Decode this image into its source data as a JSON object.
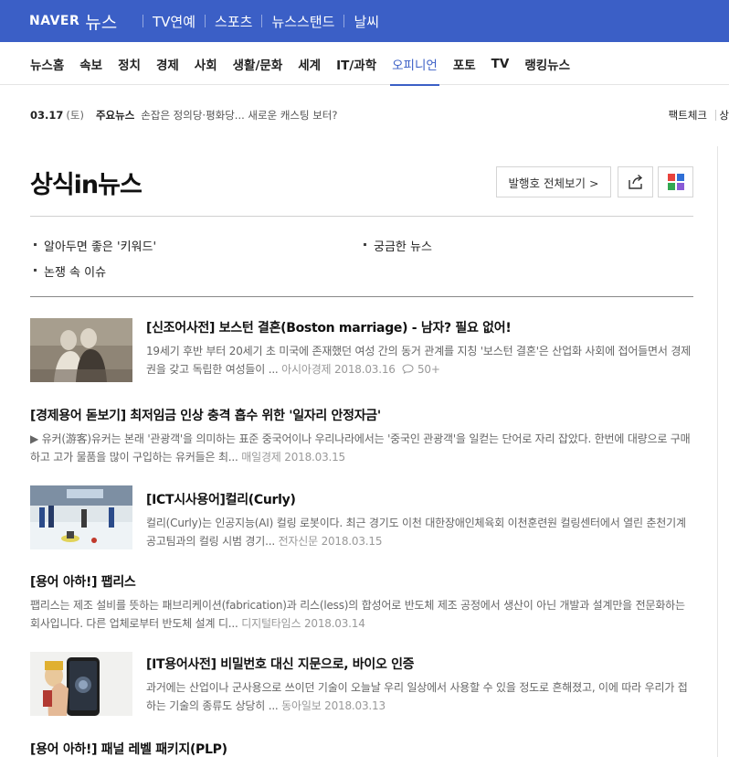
{
  "header": {
    "brand": "NAVER",
    "brand_news": "뉴스",
    "top_nav": [
      "TV연예",
      "스포츠",
      "뉴스스탠드",
      "날씨"
    ],
    "brand_color": "#3b5fc6"
  },
  "sections": [
    "뉴스홈",
    "속보",
    "정치",
    "경제",
    "사회",
    "생활/문화",
    "세계",
    "IT/과학",
    "오피니언",
    "포토",
    "TV",
    "랭킹뉴스"
  ],
  "active_section": "오피니언",
  "ticker": {
    "date": "03.17",
    "day": "(토)",
    "label": "주요뉴스",
    "headline": "손잡은 정의당·평화당... 새로운 캐스팅 보터?",
    "right_link": "팩트체크",
    "right_link2": "상"
  },
  "page": {
    "title": "상식in뉴스",
    "issues_button": "발행호 전체보기 >",
    "share_icon": "share-icon",
    "grid_icon": "grid-icon"
  },
  "subtopics": [
    "알아두면 좋은 '키워드'",
    "궁금한 뉴스",
    "논쟁 속 이슈"
  ],
  "articles": [
    {
      "title": "[신조어사전] 보스턴 결혼(Boston marriage) - 남자? 필요 없어!",
      "summary": "19세기 후반 부터 20세기 초 미국에 존재했던 여성 간의 동거 관계를 지칭 '보스턴 결혼'은 산업화 사회에 접어들면서 경제권을 갖고 독립한 여성들이 ...",
      "source": "아시아경제",
      "date": "2018.03.16",
      "comments": "50+"
    },
    {
      "title": "[경제용어 돋보기] 최저임금 인상 충격 흡수 위한 '일자리 안정자금'",
      "summary": "▶ 유커(游客)유커는 본래 '관광객'을 의미하는 표준 중국어이나 우리나라에서는 '중국인 관광객'을 일컫는 단어로 자리 잡았다. 한번에 대량으로 구매하고 고가 물품을 많이 구입하는 유커들은 최...",
      "source": "매일경제",
      "date": "2018.03.15"
    },
    {
      "title": "[ICT시사용어]컬리(Curly)",
      "summary": "컬리(Curly)는 인공지능(AI) 컬링 로봇이다. 최근 경기도 이천 대한장애인체육회 이천훈련원 컬링센터에서 열린 춘천기계공고팀과의 컬링 시범 경기...",
      "source": "전자신문",
      "date": "2018.03.15"
    },
    {
      "title": "[용어 아하!] 팹리스",
      "summary": "팹리스는 제조 설비를 뜻하는 패브리케이션(fabrication)과 리스(less)의 합성어로 반도체 제조 공정에서 생산이 아닌 개발과 설계만을 전문화하는 회사입니다. 다른 업체로부터 반도체 설계 디...",
      "source": "디지털타임스",
      "date": "2018.03.14"
    },
    {
      "title": "[IT용어사전] 비밀번호 대신 지문으로, 바이오 인증",
      "summary": "과거에는 산업이나 군사용으로 쓰이던 기술이 오늘날 우리 일상에서 사용할 수 있을 정도로 흔해졌고, 이에 따라 우리가 접하는 기술의 종류도 상당히 ...",
      "source": "동아일보",
      "date": "2018.03.13"
    },
    {
      "title": "[용어 아하!] 패널 레벨 패키지(PLP)"
    }
  ],
  "colors": {
    "grid_red": "#e8433d",
    "grid_blue": "#2f6fd6",
    "grid_green": "#33a852",
    "grid_purple": "#8a5bd6"
  }
}
